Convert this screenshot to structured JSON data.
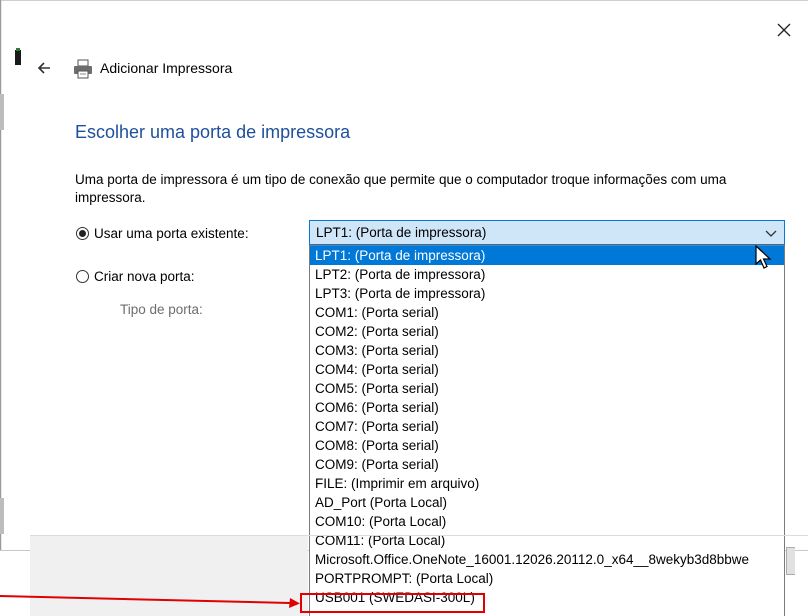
{
  "window": {
    "title": "Adicionar Impressora"
  },
  "page": {
    "heading": "Escolher uma porta de impressora",
    "description": "Uma porta de impressora é um tipo de conexão que permite que o computador troque informações com uma impressora."
  },
  "options": {
    "use_existing_label": "Usar uma porta existente:",
    "create_new_label": "Criar nova porta:",
    "port_type_label": "Tipo de porta:",
    "use_existing_selected": true
  },
  "port_select": {
    "value": "LPT1: (Porta de impressora)",
    "items": [
      "LPT1: (Porta de impressora)",
      "LPT2: (Porta de impressora)",
      "LPT3: (Porta de impressora)",
      "COM1: (Porta serial)",
      "COM2: (Porta serial)",
      "COM3: (Porta serial)",
      "COM4: (Porta serial)",
      "COM5: (Porta serial)",
      "COM6: (Porta serial)",
      "COM7: (Porta serial)",
      "COM8: (Porta serial)",
      "COM9: (Porta serial)",
      "FILE: (Imprimir em arquivo)",
      "AD_Port (Porta Local)",
      "COM10: (Porta Local)",
      "COM11: (Porta Local)",
      "Microsoft.Office.OneNote_16001.12026.20112.0_x64__8wekyb3d8bbwe",
      "PORTPROMPT: (Porta Local)",
      "USB001 (SWEDASI-300L)"
    ],
    "highlighted_index": 0
  },
  "colors": {
    "accent": "#0078d7",
    "heading": "#1e4f9c",
    "annotation": "#e00000"
  },
  "icons": {
    "close": "close-icon",
    "back": "back-arrow-icon",
    "printer": "printer-icon",
    "chevron": "chevron-down-icon"
  }
}
